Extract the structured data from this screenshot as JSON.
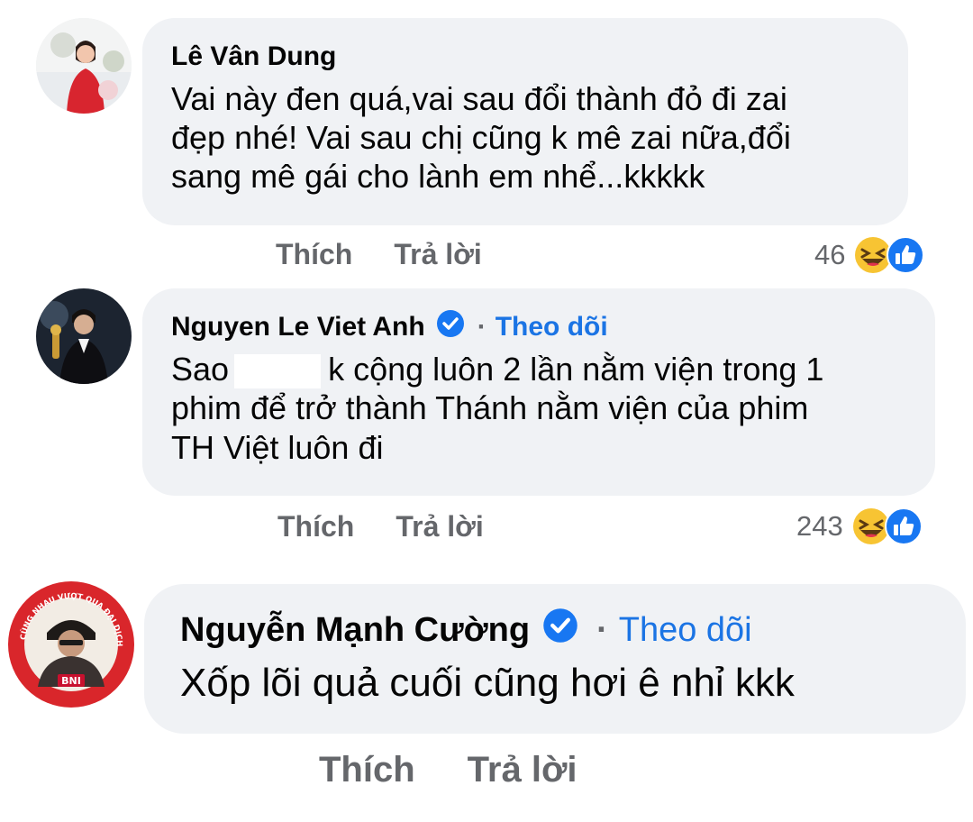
{
  "comments": [
    {
      "author": "Lê Vân Dung",
      "verified": false,
      "follow_label": "",
      "text_lines": [
        "Vai này đen quá,vai sau đổi thành đỏ đi zai",
        "đẹp nhé! Vai sau chị cũng k mê zai nữa,đổi",
        "sang mê gái cho lành em nhể...kkkkk"
      ],
      "like_label": "Thích",
      "reply_label": "Trả lời",
      "reaction_count": "46",
      "reaction_icons": [
        "haha-icon",
        "like-icon"
      ]
    },
    {
      "author": "Nguyen Le Viet Anh",
      "verified": true,
      "separator": "·",
      "follow_label": "Theo dõi",
      "text_line1_before": "Sao",
      "text_line1_after": "k cộng luôn 2 lần nằm viện trong 1",
      "text_lines": [
        "phim để trở thành Thánh nằm viện của phim",
        "TH Việt luôn đi"
      ],
      "like_label": "Thích",
      "reply_label": "Trả lời",
      "reaction_count": "243",
      "reaction_icons": [
        "haha-icon",
        "like-icon"
      ]
    },
    {
      "author": "Nguyễn Mạnh Cường",
      "verified": true,
      "separator": "·",
      "follow_label": "Theo dõi",
      "text_lines": [
        "Xốp lõi quả cuối cũng hơi ê nhỉ kkk"
      ],
      "like_label": "Thích",
      "reply_label": "Trả lời",
      "avatar_badge_text": "BNI",
      "avatar_ring_text": "CÙNG NHAU VƯỢT QUA ĐẠI DỊCH COVID"
    }
  ],
  "colors": {
    "bubble": "#f0f2f5",
    "link": "#1b74e4",
    "secondary_text": "#65676b",
    "verified": "#1877f2",
    "haha": "#f7c433",
    "like": "#1877f2",
    "avatar_ring": "#d9262b"
  }
}
